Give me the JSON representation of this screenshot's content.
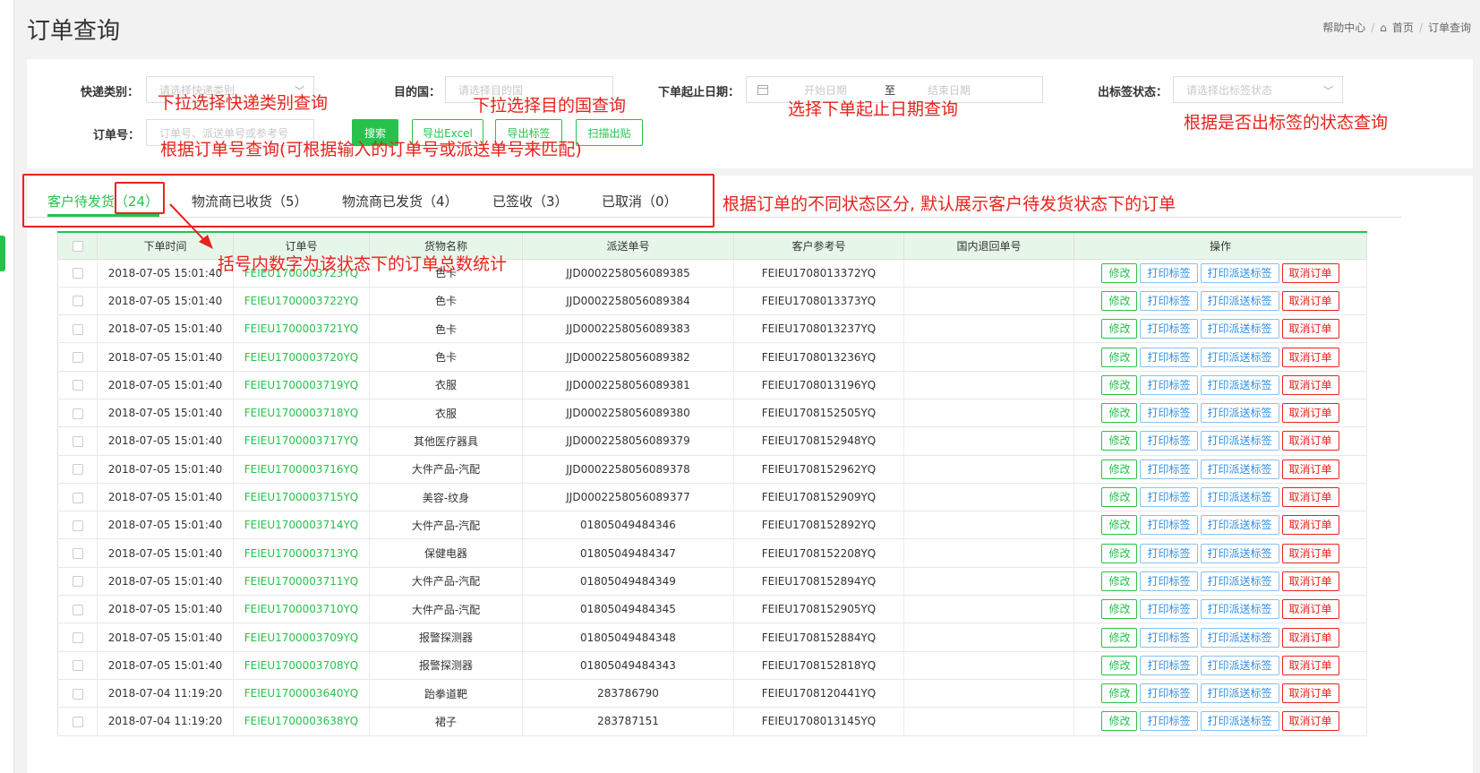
{
  "page": {
    "title": "订单查询",
    "breadcrumb": [
      "帮助中心",
      "首页",
      "订单查询"
    ]
  },
  "search": {
    "express_type": {
      "label": "快递类别：",
      "placeholder": "请选择快递类别"
    },
    "destination": {
      "label": "目的国：",
      "placeholder": "请选择目的国"
    },
    "date_range": {
      "label": "下单起止日期：",
      "start_placeholder": "开始日期",
      "separator": "至",
      "end_placeholder": "结束日期"
    },
    "label_status": {
      "label": "出标签状态：",
      "placeholder": "请选择出标签状态"
    },
    "order_no": {
      "label": "订单号：",
      "placeholder": "订单号、派送单号或参考号"
    },
    "buttons": {
      "search": "搜索",
      "export_excel": "导出Excel",
      "export_labels": "导出标签",
      "scan_out": "扫描出贴"
    }
  },
  "annotations": {
    "express_type": "下拉选择快递类别查询",
    "destination": "下拉选择目的国查询",
    "date_range": "选择下单起止日期查询",
    "label_status": "根据是否出标签的状态查询",
    "order_no": "根据订单号查询(可根据输入的订单号或派送单号来匹配)",
    "tabs": "根据订单的不同状态区分, 默认展示客户待发货状态下的订单",
    "count": "括号内数字为该状态下的订单总数统计"
  },
  "tabs": [
    {
      "label": "客户待发货（24）",
      "active": true
    },
    {
      "label": "物流商已收货（5）",
      "active": false
    },
    {
      "label": "物流商已发货（4）",
      "active": false
    },
    {
      "label": "已签收（3）",
      "active": false
    },
    {
      "label": "已取消（0）",
      "active": false
    }
  ],
  "table": {
    "headers": [
      "下单时间",
      "订单号",
      "货物名称",
      "派送单号",
      "客户参考号",
      "国内退回单号",
      "操作"
    ],
    "actions": {
      "edit": "修改",
      "print_label": "打印标签",
      "print_delivery": "打印派送标签",
      "cancel": "取消订单"
    },
    "rows": [
      {
        "time": "2018-07-05 15:01:40",
        "order_no": "FEIEU1700003723YQ",
        "goods": "色卡",
        "delivery_no": "JJD0002258056089385",
        "ref_no": "FEIEU1708013372YQ",
        "return_no": ""
      },
      {
        "time": "2018-07-05 15:01:40",
        "order_no": "FEIEU1700003722YQ",
        "goods": "色卡",
        "delivery_no": "JJD0002258056089384",
        "ref_no": "FEIEU1708013373YQ",
        "return_no": ""
      },
      {
        "time": "2018-07-05 15:01:40",
        "order_no": "FEIEU1700003721YQ",
        "goods": "色卡",
        "delivery_no": "JJD0002258056089383",
        "ref_no": "FEIEU1708013237YQ",
        "return_no": ""
      },
      {
        "time": "2018-07-05 15:01:40",
        "order_no": "FEIEU1700003720YQ",
        "goods": "色卡",
        "delivery_no": "JJD0002258056089382",
        "ref_no": "FEIEU1708013236YQ",
        "return_no": ""
      },
      {
        "time": "2018-07-05 15:01:40",
        "order_no": "FEIEU1700003719YQ",
        "goods": "衣服",
        "delivery_no": "JJD0002258056089381",
        "ref_no": "FEIEU1708013196YQ",
        "return_no": ""
      },
      {
        "time": "2018-07-05 15:01:40",
        "order_no": "FEIEU1700003718YQ",
        "goods": "衣服",
        "delivery_no": "JJD0002258056089380",
        "ref_no": "FEIEU1708152505YQ",
        "return_no": ""
      },
      {
        "time": "2018-07-05 15:01:40",
        "order_no": "FEIEU1700003717YQ",
        "goods": "其他医疗器具",
        "delivery_no": "JJD0002258056089379",
        "ref_no": "FEIEU1708152948YQ",
        "return_no": ""
      },
      {
        "time": "2018-07-05 15:01:40",
        "order_no": "FEIEU1700003716YQ",
        "goods": "大件产品-汽配",
        "delivery_no": "JJD0002258056089378",
        "ref_no": "FEIEU1708152962YQ",
        "return_no": ""
      },
      {
        "time": "2018-07-05 15:01:40",
        "order_no": "FEIEU1700003715YQ",
        "goods": "美容-纹身",
        "delivery_no": "JJD0002258056089377",
        "ref_no": "FEIEU1708152909YQ",
        "return_no": ""
      },
      {
        "time": "2018-07-05 15:01:40",
        "order_no": "FEIEU1700003714YQ",
        "goods": "大件产品-汽配",
        "delivery_no": "01805049484346",
        "ref_no": "FEIEU1708152892YQ",
        "return_no": ""
      },
      {
        "time": "2018-07-05 15:01:40",
        "order_no": "FEIEU1700003713YQ",
        "goods": "保健电器",
        "delivery_no": "01805049484347",
        "ref_no": "FEIEU1708152208YQ",
        "return_no": ""
      },
      {
        "time": "2018-07-05 15:01:40",
        "order_no": "FEIEU1700003711YQ",
        "goods": "大件产品-汽配",
        "delivery_no": "01805049484349",
        "ref_no": "FEIEU1708152894YQ",
        "return_no": ""
      },
      {
        "time": "2018-07-05 15:01:40",
        "order_no": "FEIEU1700003710YQ",
        "goods": "大件产品-汽配",
        "delivery_no": "01805049484345",
        "ref_no": "FEIEU1708152905YQ",
        "return_no": ""
      },
      {
        "time": "2018-07-05 15:01:40",
        "order_no": "FEIEU1700003709YQ",
        "goods": "报警探测器",
        "delivery_no": "01805049484348",
        "ref_no": "FEIEU1708152884YQ",
        "return_no": ""
      },
      {
        "time": "2018-07-05 15:01:40",
        "order_no": "FEIEU1700003708YQ",
        "goods": "报警探测器",
        "delivery_no": "01805049484343",
        "ref_no": "FEIEU1708152818YQ",
        "return_no": ""
      },
      {
        "time": "2018-07-04 11:19:20",
        "order_no": "FEIEU1700003640YQ",
        "goods": "跆拳道靶",
        "delivery_no": "283786790",
        "ref_no": "FEIEU1708120441YQ",
        "return_no": ""
      },
      {
        "time": "2018-07-04 11:19:20",
        "order_no": "FEIEU1700003638YQ",
        "goods": "裙子",
        "delivery_no": "283787151",
        "ref_no": "FEIEU1708013145YQ",
        "return_no": ""
      }
    ]
  },
  "colors": {
    "accent": "#27c24c",
    "annotation": "#e8231c",
    "print": "#2f8fe8"
  }
}
